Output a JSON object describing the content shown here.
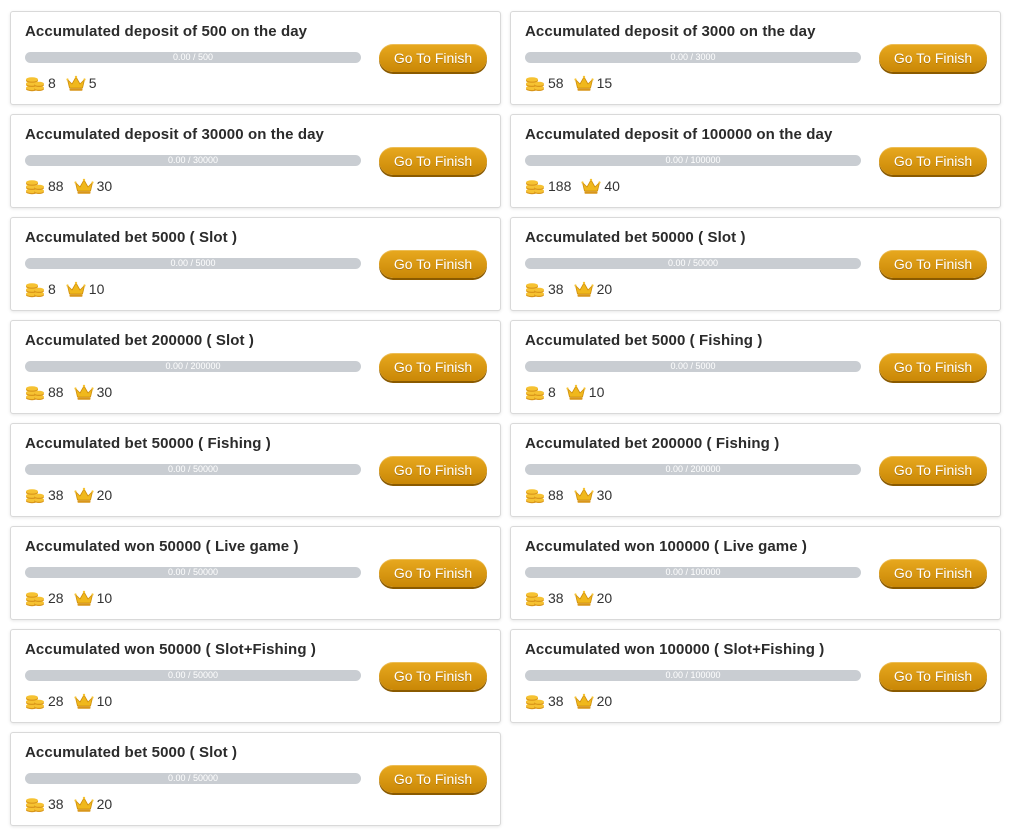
{
  "tasks": [
    {
      "title": "Accumulated deposit of 500 on the day",
      "progress_text": "0.00 / 500",
      "progress": 0,
      "coins": "8",
      "crowns": "5",
      "button": "Go To Finish"
    },
    {
      "title": "Accumulated deposit of 3000 on the day",
      "progress_text": "0.00 / 3000",
      "progress": 0,
      "coins": "58",
      "crowns": "15",
      "button": "Go To Finish"
    },
    {
      "title": "Accumulated deposit of 30000 on the day",
      "progress_text": "0.00 / 30000",
      "progress": 0,
      "coins": "88",
      "crowns": "30",
      "button": "Go To Finish"
    },
    {
      "title": "Accumulated deposit of 100000 on the day",
      "progress_text": "0.00 / 100000",
      "progress": 0,
      "coins": "188",
      "crowns": "40",
      "button": "Go To Finish"
    },
    {
      "title": "Accumulated bet 5000 ( Slot )",
      "progress_text": "0.00 / 5000",
      "progress": 0,
      "coins": "8",
      "crowns": "10",
      "button": "Go To Finish"
    },
    {
      "title": "Accumulated bet 50000 ( Slot )",
      "progress_text": "0.00 / 50000",
      "progress": 0,
      "coins": "38",
      "crowns": "20",
      "button": "Go To Finish"
    },
    {
      "title": "Accumulated bet 200000 ( Slot )",
      "progress_text": "0.00 / 200000",
      "progress": 0,
      "coins": "88",
      "crowns": "30",
      "button": "Go To Finish"
    },
    {
      "title": "Accumulated bet 5000 ( Fishing )",
      "progress_text": "0.00 / 5000",
      "progress": 0,
      "coins": "8",
      "crowns": "10",
      "button": "Go To Finish"
    },
    {
      "title": "Accumulated bet 50000 ( Fishing )",
      "progress_text": "0.00 / 50000",
      "progress": 0,
      "coins": "38",
      "crowns": "20",
      "button": "Go To Finish"
    },
    {
      "title": "Accumulated bet 200000 ( Fishing )",
      "progress_text": "0.00 / 200000",
      "progress": 0,
      "coins": "88",
      "crowns": "30",
      "button": "Go To Finish"
    },
    {
      "title": "Accumulated won 50000 ( Live game )",
      "progress_text": "0.00 / 50000",
      "progress": 0,
      "coins": "28",
      "crowns": "10",
      "button": "Go To Finish"
    },
    {
      "title": "Accumulated won 100000 ( Live game )",
      "progress_text": "0.00 / 100000",
      "progress": 0,
      "coins": "38",
      "crowns": "20",
      "button": "Go To Finish"
    },
    {
      "title": "Accumulated won 50000 ( Slot+Fishing )",
      "progress_text": "0.00 / 50000",
      "progress": 0,
      "coins": "28",
      "crowns": "10",
      "button": "Go To Finish"
    },
    {
      "title": "Accumulated won 100000 ( Slot+Fishing )",
      "progress_text": "0.00 / 100000",
      "progress": 0,
      "coins": "38",
      "crowns": "20",
      "button": "Go To Finish"
    },
    {
      "title": "Accumulated bet 5000 ( Slot )",
      "progress_text": "0.00 / 50000",
      "progress": 0,
      "coins": "38",
      "crowns": "20",
      "button": "Go To Finish"
    }
  ],
  "icons": {
    "coin": "coin-stack-icon",
    "crown": "crown-icon"
  },
  "colors": {
    "button": "#d99712",
    "progress_track": "#c9cdd2",
    "icon_gold": "#f0b81c"
  }
}
